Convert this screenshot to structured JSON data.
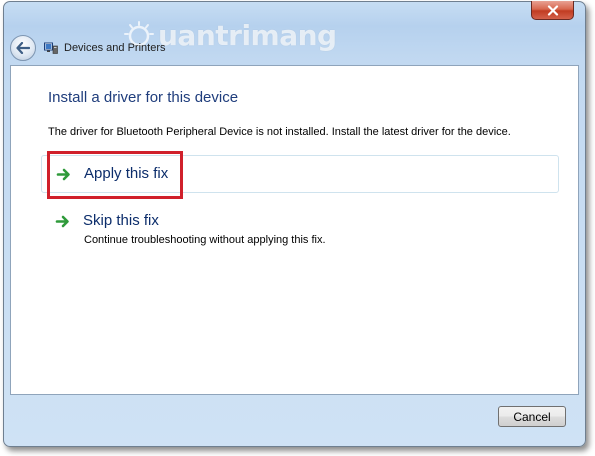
{
  "window": {
    "breadcrumb_label": "Devices and Printers",
    "watermark_text": "uantrimang"
  },
  "dialog": {
    "heading": "Install a driver for this device",
    "description": "The driver for Bluetooth Peripheral Device is not installed. Install the latest driver for the device.",
    "options": [
      {
        "title": "Apply this fix",
        "subtitle": "",
        "icon": "green-arrow-icon"
      },
      {
        "title": "Skip this fix",
        "subtitle": "Continue troubleshooting without applying this fix.",
        "icon": "green-arrow-icon"
      }
    ],
    "cancel_label": "Cancel"
  },
  "colors": {
    "heading": "#1f3d7c",
    "option_title": "#0c2d6b",
    "arrow": "#2f9a3a",
    "highlight": "#d0202b",
    "close_button": "#c13c22"
  }
}
